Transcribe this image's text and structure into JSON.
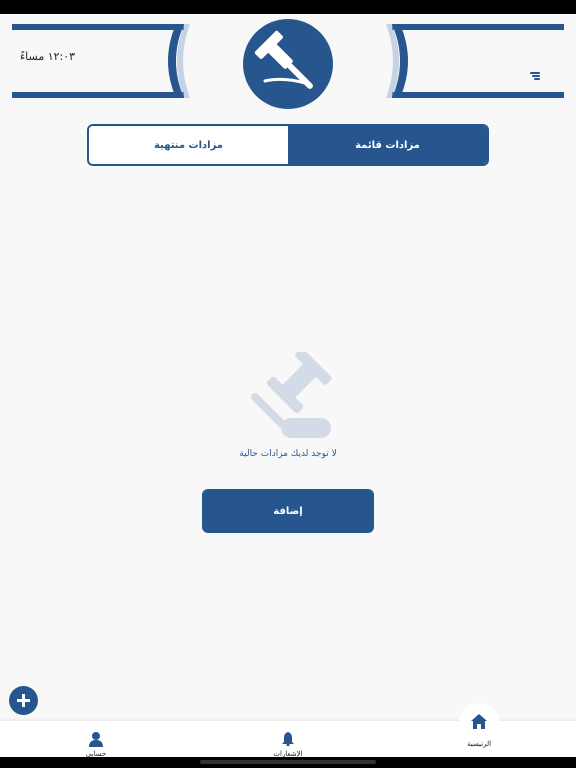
{
  "header": {
    "time": "١٢:٠٣ مساءً",
    "logo_text": "مزاد"
  },
  "tabs": [
    {
      "label": "مزادات منتهية"
    },
    {
      "label": "مزادات قائمة"
    }
  ],
  "empty_state": {
    "message": "لا توجد لديك مزادات حالية"
  },
  "main": {
    "add_label": "إضافة"
  },
  "bottom_nav": {
    "items": [
      {
        "label": "حسابي"
      },
      {
        "label": "الإشعارات"
      },
      {
        "label": "الرئيسية"
      }
    ]
  },
  "colors": {
    "primary": "#27568f",
    "empty_icon": "#d3dbe6",
    "background": "#f8f8f8"
  }
}
